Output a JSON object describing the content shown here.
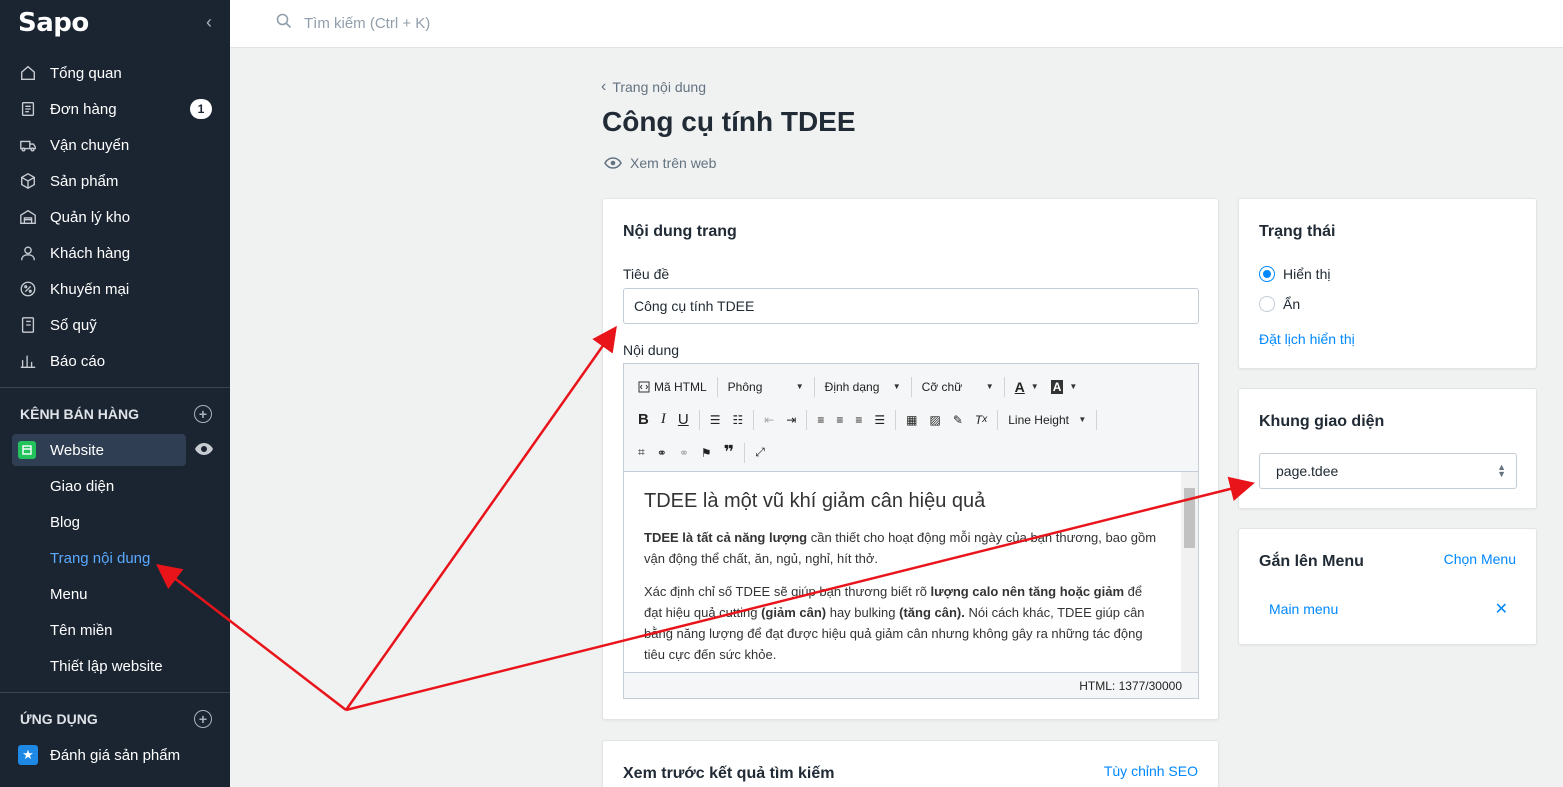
{
  "sidebar": {
    "logo": "Sapo",
    "nav": [
      {
        "label": "Tổng quan",
        "icon": "home-icon"
      },
      {
        "label": "Đơn hàng",
        "icon": "order-icon",
        "badge": "1"
      },
      {
        "label": "Vận chuyển",
        "icon": "truck-icon"
      },
      {
        "label": "Sản phẩm",
        "icon": "box-icon"
      },
      {
        "label": "Quản lý kho",
        "icon": "warehouse-icon"
      },
      {
        "label": "Khách hàng",
        "icon": "user-icon"
      },
      {
        "label": "Khuyến mại",
        "icon": "percent-icon"
      },
      {
        "label": "Sổ quỹ",
        "icon": "cashbook-icon"
      },
      {
        "label": "Báo cáo",
        "icon": "chart-icon"
      }
    ],
    "sales_channel_heading": "KÊNH BÁN HÀNG",
    "website_label": "Website",
    "website_sub": [
      "Giao diện",
      "Blog",
      "Trang nội dung",
      "Menu",
      "Tên miền",
      "Thiết lập website"
    ],
    "apps_heading": "ỨNG DỤNG",
    "app_item": "Đánh giá sản phẩm"
  },
  "topbar": {
    "search_placeholder": "Tìm kiếm (Ctrl + K)"
  },
  "page": {
    "breadcrumb": "Trang nội dung",
    "title": "Công cụ tính TDEE",
    "view_on_web": "Xem trên web"
  },
  "content_card": {
    "title": "Nội dung trang",
    "title_label": "Tiêu đề",
    "title_value": "Công cụ tính TDEE",
    "content_label": "Nội dung",
    "toolbar": {
      "html": "Mã HTML",
      "font": "Phông",
      "format": "Định dạng",
      "size": "Cỡ chữ",
      "line_height": "Line Height"
    },
    "body": {
      "heading": "TDEE là một vũ khí giảm cân hiệu quả",
      "p1_bold": "TDEE là tất cả năng lượng",
      "p1_rest": " cần thiết cho hoạt động mỗi ngày của bạn thương, bao gồm vận động thể chất, ăn, ngủ, nghỉ, hít thở.",
      "p2_a": "Xác định chỉ số TDEE sẽ giúp bạn thương biết rõ ",
      "p2_b": "lượng calo nên tăng hoặc giảm",
      "p2_c": " để đạt hiệu quả cutting ",
      "p2_d": "(giảm cân)",
      "p2_e": " hay bulking ",
      "p2_f": "(tăng cân).",
      "p2_g": " Nói cách khác, TDEE giúp cân bằng năng lượng để đạt được hiệu quả giảm cân nhưng không gây ra những tác động tiêu cực đến sức khỏe."
    },
    "status": "HTML: 1377/30000"
  },
  "status_card": {
    "title": "Trạng thái",
    "options": [
      "Hiển thị",
      "Ẩn"
    ],
    "schedule_link": "Đặt lịch hiển thị"
  },
  "template_card": {
    "title": "Khung giao diện",
    "selected": "page.tdee"
  },
  "menu_card": {
    "title": "Gắn lên Menu",
    "choose": "Chọn Menu",
    "item": "Main menu"
  },
  "seo_card": {
    "title": "Xem trước kết quả tìm kiếm",
    "link": "Tùy chỉnh SEO"
  },
  "colors": {
    "accent": "#0088ff",
    "sidebar": "#1b2532",
    "annotation": "#e8141a"
  }
}
